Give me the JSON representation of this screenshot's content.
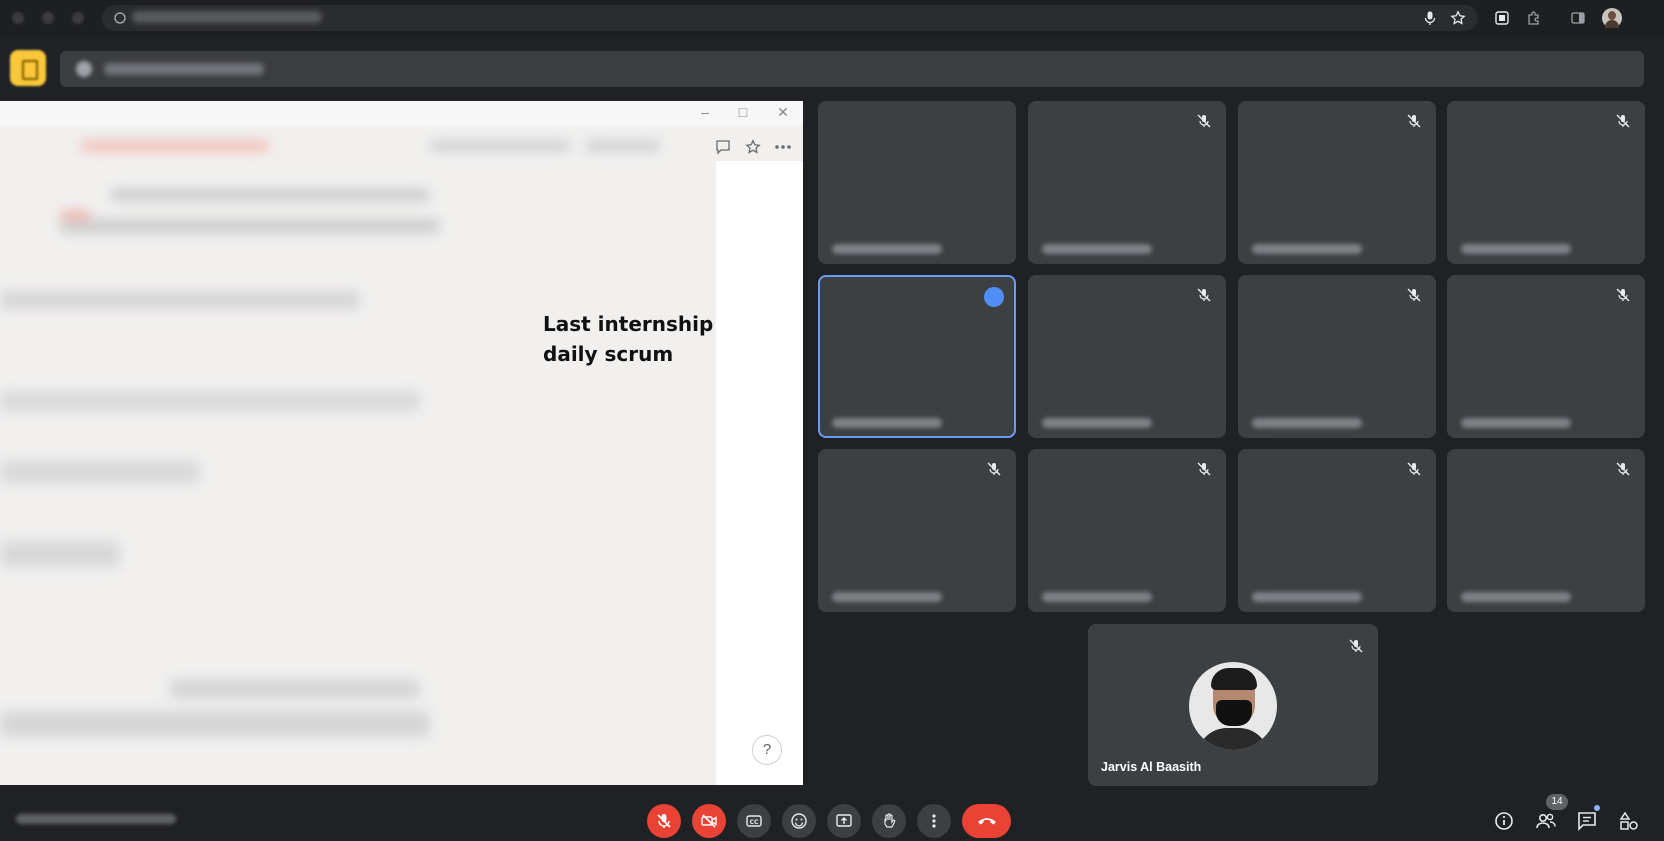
{
  "browser": {
    "icons": [
      "back-icon",
      "forward-icon",
      "reload-icon",
      "site-info-icon",
      "microphone-icon",
      "star-icon",
      "extension-icon",
      "puzzle-icon",
      "sidepanel-icon",
      "profile-avatar"
    ]
  },
  "meeting": {
    "app_icon": "meet-icon"
  },
  "presentation": {
    "slide_text_line1": "Last internship",
    "slide_text_line2": "daily scrum",
    "help_label": "?",
    "window_controls": [
      "minimize-icon",
      "maximize-icon",
      "close-icon"
    ],
    "toolbar_icons": [
      "comment-icon",
      "star-icon",
      "more-icon"
    ]
  },
  "participants": {
    "tiles": [
      {
        "muted": false,
        "speaking": false
      },
      {
        "muted": true,
        "speaking": false
      },
      {
        "muted": true,
        "speaking": false
      },
      {
        "muted": true,
        "speaking": false
      },
      {
        "muted": false,
        "speaking": true
      },
      {
        "muted": true,
        "speaking": false
      },
      {
        "muted": true,
        "speaking": false
      },
      {
        "muted": true,
        "speaking": false
      },
      {
        "muted": true,
        "speaking": false
      },
      {
        "muted": true,
        "speaking": false
      },
      {
        "muted": true,
        "speaking": false
      },
      {
        "muted": true,
        "speaking": false
      }
    ],
    "self_name": "Jarvis Al Baasith",
    "people_count": "14"
  },
  "controls": {
    "buttons": [
      "mic-off-icon",
      "camera-off-icon",
      "captions-icon",
      "emoji-icon",
      "present-icon",
      "raise-hand-icon",
      "more-options-icon",
      "end-call-icon"
    ],
    "right_buttons": [
      "info-icon",
      "people-icon",
      "chat-icon",
      "activities-icon"
    ],
    "colors": {
      "danger": "#ea4335",
      "button_bg": "#3c4043",
      "accent": "#8ab4f8"
    }
  }
}
